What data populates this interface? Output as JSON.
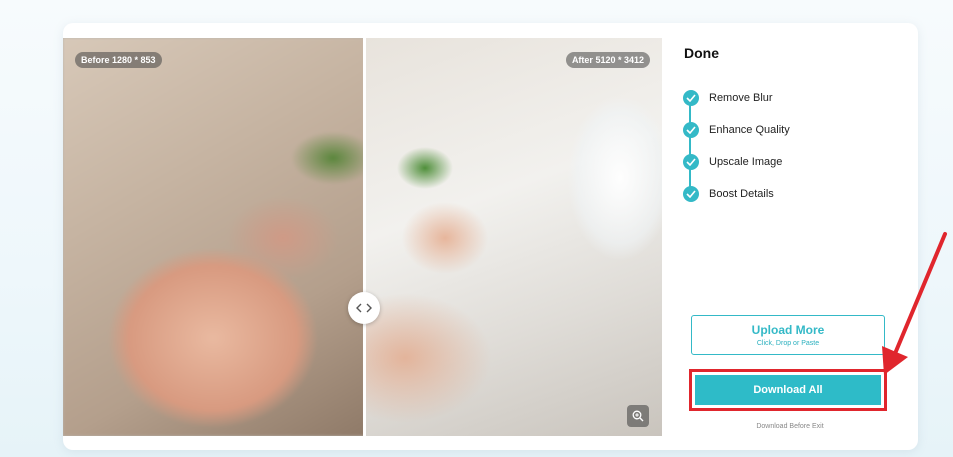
{
  "preview": {
    "before_label": "Before 1280 * 853",
    "after_label": "After 5120 * 3412"
  },
  "panel": {
    "title": "Done",
    "steps": [
      {
        "label": "Remove Blur"
      },
      {
        "label": "Enhance Quality"
      },
      {
        "label": "Upscale Image"
      },
      {
        "label": "Boost Details"
      }
    ],
    "upload_button": {
      "label": "Upload More",
      "sublabel": "Click, Drop or Paste"
    },
    "download_button": {
      "label": "Download All"
    },
    "download_note": "Download Before Exit"
  },
  "icons": {
    "step": "check-icon",
    "handle": "compare-handle-icon",
    "zoom": "zoom-in-icon"
  },
  "colors": {
    "accent": "#2ebbc8",
    "highlight": "#e0262d"
  }
}
